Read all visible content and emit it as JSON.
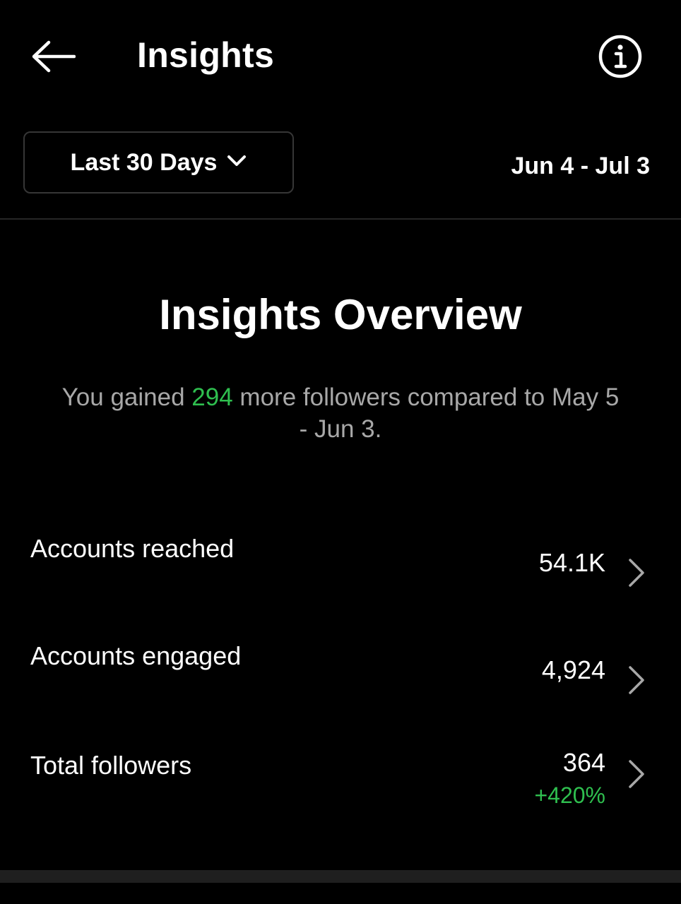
{
  "header": {
    "title": "Insights"
  },
  "filter": {
    "range_label": "Last 30 Days",
    "date_range": "Jun 4 - Jul 3"
  },
  "overview": {
    "title": "Insights Overview",
    "summary_prefix": "You gained ",
    "summary_highlight": "294",
    "summary_suffix": " more followers compared to May 5 - Jun 3."
  },
  "metrics": [
    {
      "label": "Accounts reached",
      "value": "54.1K"
    },
    {
      "label": "Accounts engaged",
      "value": "4,924"
    },
    {
      "label": "Total followers",
      "value": "364",
      "delta": "+420%"
    }
  ],
  "icons": {
    "back": "arrow-left-icon",
    "info": "info-icon",
    "dropdown": "chevron-down-icon",
    "row": "chevron-right-icon"
  },
  "colors": {
    "background": "#000000",
    "text_primary": "#ffffff",
    "text_secondary": "#a8a8a8",
    "positive": "#2fbf4f",
    "border": "#363636"
  }
}
